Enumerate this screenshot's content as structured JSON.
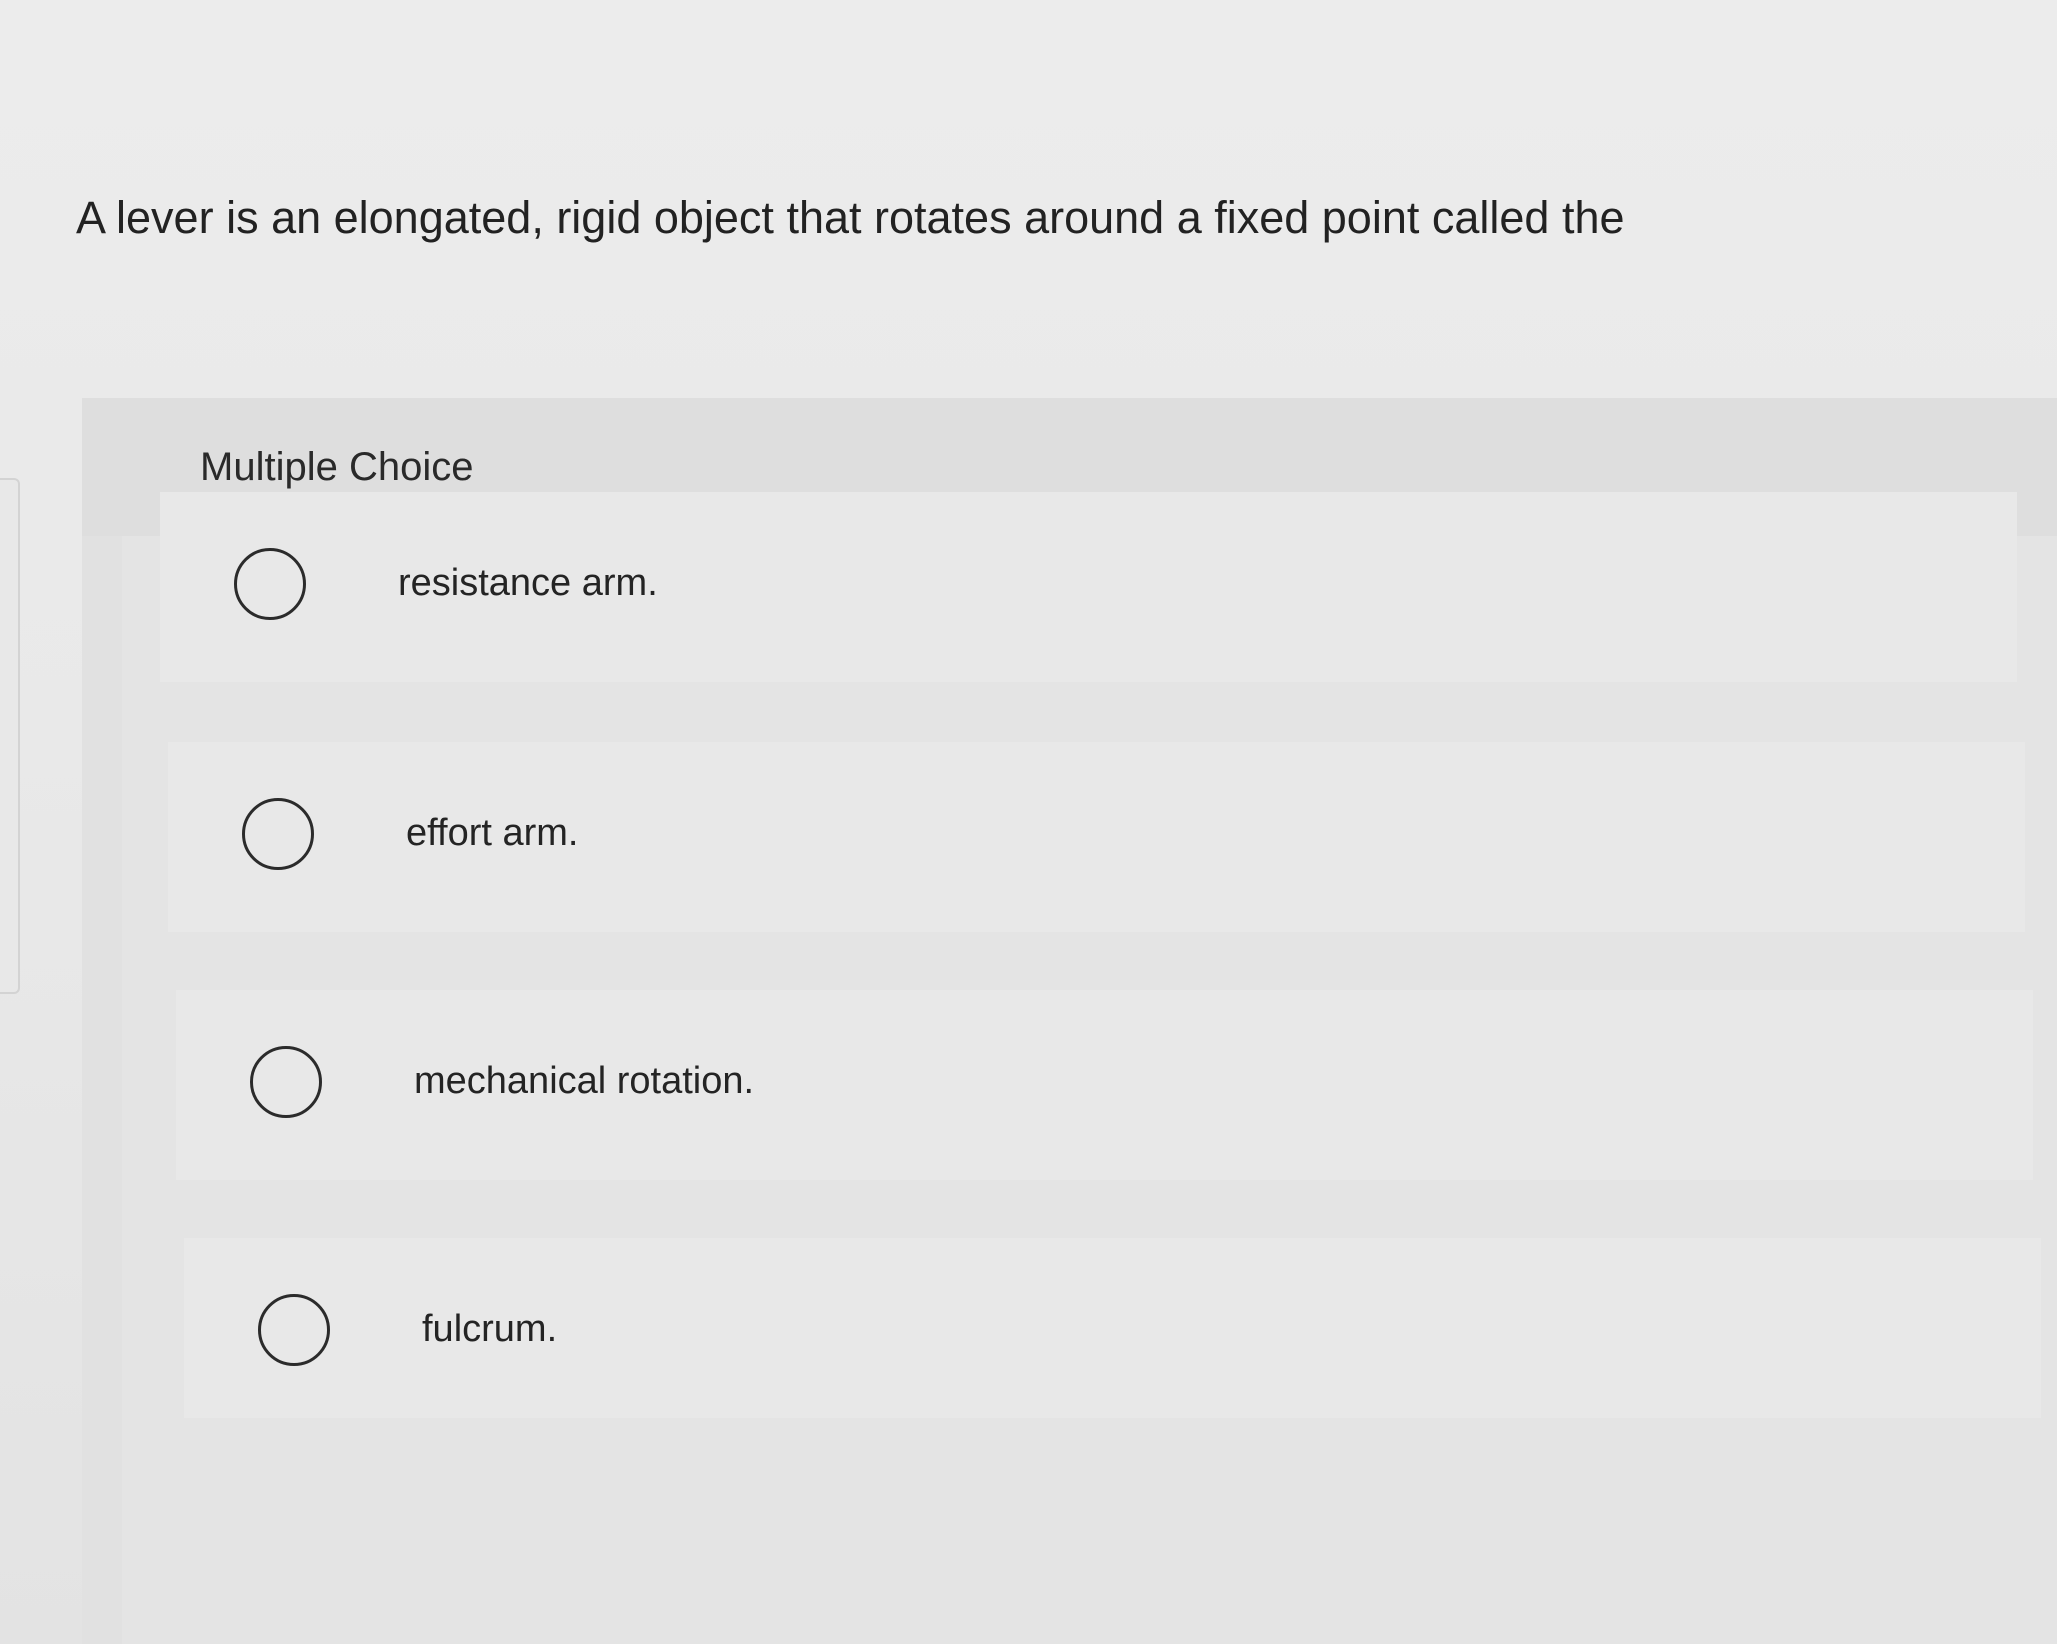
{
  "question": {
    "text": "A lever is an elongated, rigid object that rotates around a fixed point called the"
  },
  "multiple_choice": {
    "label": "Multiple Choice",
    "options": [
      {
        "text": "resistance arm.",
        "selected": false
      },
      {
        "text": "effort arm.",
        "selected": false
      },
      {
        "text": "mechanical rotation.",
        "selected": false
      },
      {
        "text": "fulcrum.",
        "selected": false
      }
    ]
  },
  "colors": {
    "background": "#eaeaea",
    "panel": "#e1e1e1",
    "option_background": "#e8e8e8",
    "text": "#222222",
    "radio_border": "#2b2b2b"
  }
}
